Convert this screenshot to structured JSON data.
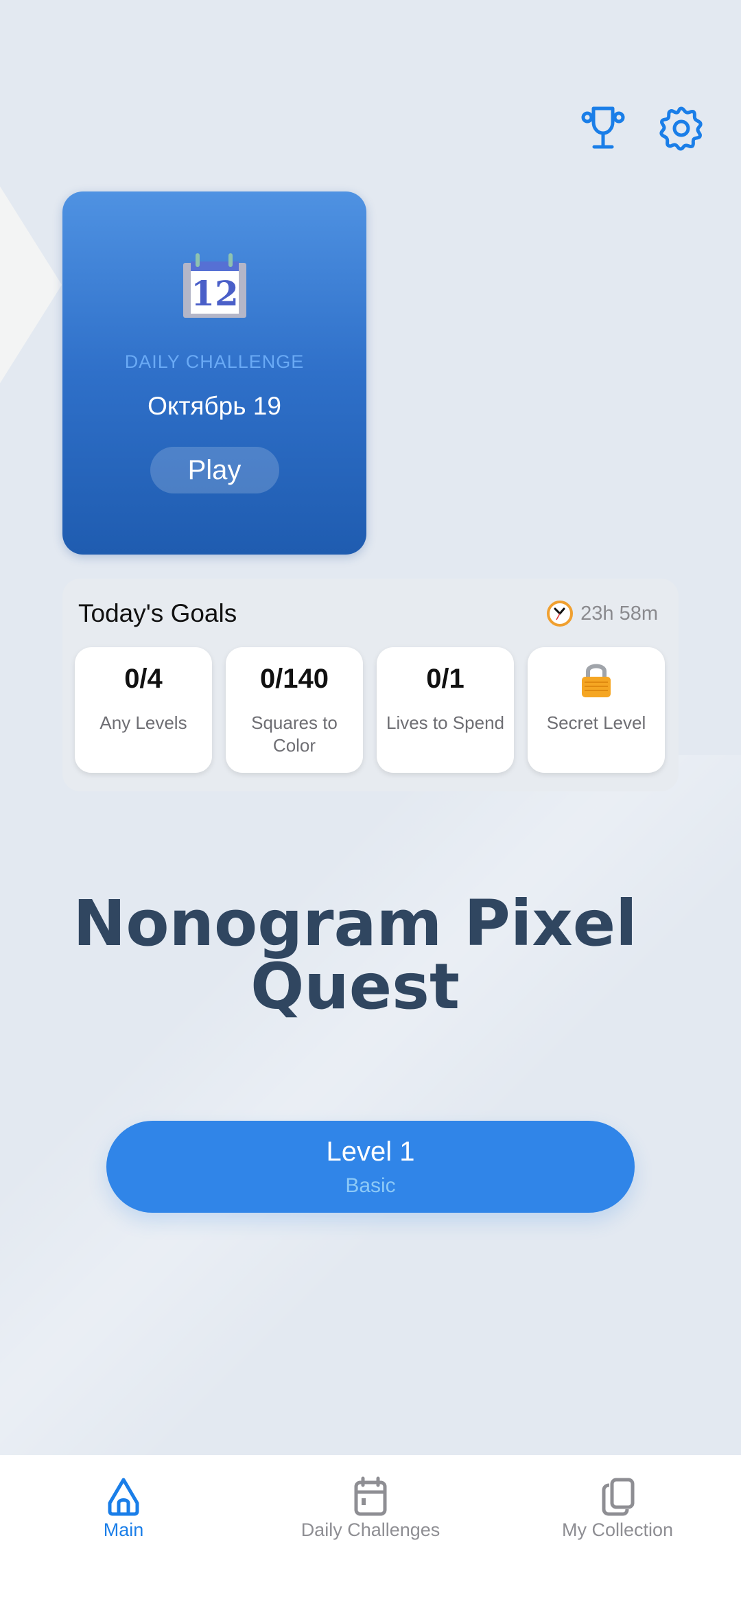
{
  "colors": {
    "accent": "#1a7ee8",
    "card_blue": "#2f70c9",
    "level_button": "#3085e8",
    "title_text": "#304660",
    "inactive_tab": "#8e8e93"
  },
  "header": {
    "icons": [
      "trophy-icon",
      "gear-icon"
    ]
  },
  "daily_challenge": {
    "calendar_day": "12",
    "label": "DAILY CHALLENGE",
    "date": "Октябрь 19",
    "play_label": "Play"
  },
  "goals": {
    "title": "Today's Goals",
    "timer": "23h 58m",
    "items": [
      {
        "value": "0/4",
        "label": "Any Levels"
      },
      {
        "value": "0/140",
        "label": "Squares to Color"
      },
      {
        "value": "0/1",
        "label": "Lives to Spend"
      },
      {
        "value": "",
        "icon": "lock-icon",
        "label": "Secret Level"
      }
    ]
  },
  "app_title": "Nonogram Pixel Quest",
  "level_button": {
    "title": "Level 1",
    "subtitle": "Basic"
  },
  "tabbar": {
    "items": [
      {
        "label": "Main",
        "icon": "home-icon",
        "active": true
      },
      {
        "label": "Daily Challenges",
        "icon": "calendar-icon",
        "active": false
      },
      {
        "label": "My Collection",
        "icon": "collection-icon",
        "active": false
      }
    ]
  }
}
